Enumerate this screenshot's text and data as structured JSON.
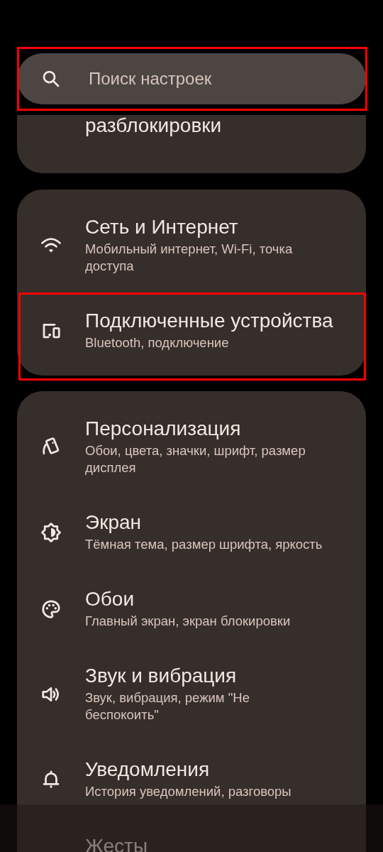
{
  "search": {
    "placeholder": "Поиск настроек",
    "highlighted": true
  },
  "groups": [
    {
      "items": [
        {
          "title": "разблокировки",
          "highlighted": false
        }
      ]
    },
    {
      "items": [
        {
          "title": "Сеть и Интернет",
          "subtitle": "Мобильный интернет, Wi-Fi, точка доступа",
          "highlighted": false
        },
        {
          "title": "Подключенные устройства",
          "subtitle": "Bluetooth, подключение",
          "highlighted": true
        }
      ]
    },
    {
      "items": [
        {
          "title": "Персонализация",
          "subtitle": "Обои, цвета, значки, шрифт, размер дисплея",
          "highlighted": false
        },
        {
          "title": "Экран",
          "subtitle": "Тёмная тема, размер шрифта, яркость",
          "highlighted": false
        },
        {
          "title": "Обои",
          "subtitle": "Главный экран, экран блокировки",
          "highlighted": false
        },
        {
          "title": "Звук и вибрация",
          "subtitle": "Звук, вибрация, режим \"Не беспокоить\"",
          "highlighted": false
        },
        {
          "title": "Уведомления",
          "subtitle": "История уведомлений, разговоры",
          "highlighted": false
        },
        {
          "title": "Жесты",
          "highlighted": false
        }
      ]
    }
  ]
}
